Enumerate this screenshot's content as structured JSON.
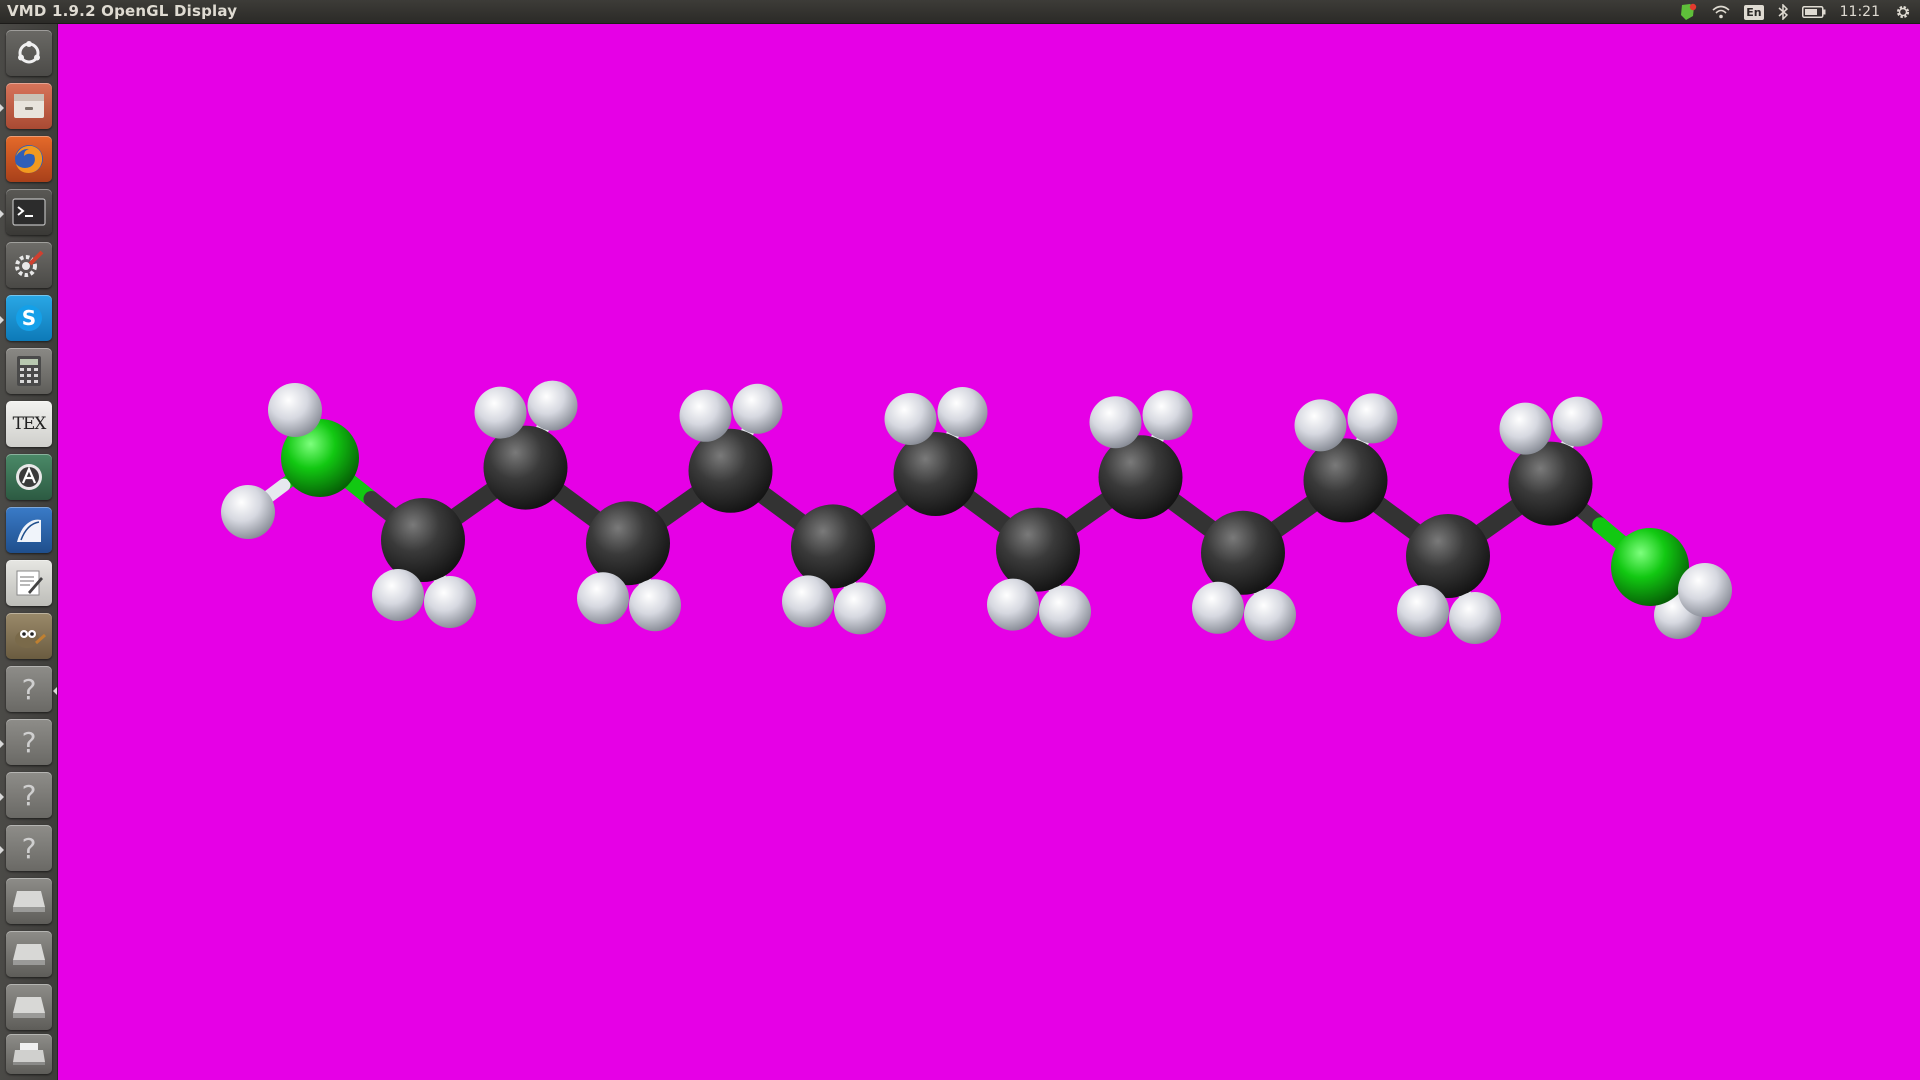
{
  "window": {
    "title": "VMD 1.9.2 OpenGL Display"
  },
  "tray": {
    "keyboard_label": "En",
    "clock": "11:21",
    "icons": [
      "update-shield-icon",
      "wifi-icon",
      "keyboard-layout-icon",
      "bluetooth-icon",
      "battery-icon",
      "settings-gear-icon"
    ]
  },
  "launcher": {
    "items": [
      {
        "name": "dash-home-icon",
        "tooltip": ""
      },
      {
        "name": "files-icon",
        "tooltip": ""
      },
      {
        "name": "firefox-icon",
        "tooltip": ""
      },
      {
        "name": "terminal-icon",
        "tooltip": ""
      },
      {
        "name": "system-settings-icon",
        "tooltip": ""
      },
      {
        "name": "skype-icon",
        "tooltip": ""
      },
      {
        "name": "calculator-icon",
        "tooltip": ""
      },
      {
        "name": "tex-icon",
        "text": "TEX"
      },
      {
        "name": "software-updater-icon",
        "tooltip": ""
      },
      {
        "name": "writer-icon",
        "tooltip": ""
      },
      {
        "name": "text-editor-icon",
        "tooltip": ""
      },
      {
        "name": "gimp-icon",
        "tooltip": ""
      },
      {
        "name": "unknown-app-icon-1",
        "text": "?"
      },
      {
        "name": "unknown-app-icon-2",
        "text": "?"
      },
      {
        "name": "unknown-app-icon-3",
        "text": "?"
      },
      {
        "name": "unknown-app-icon-4",
        "text": "?"
      },
      {
        "name": "drive-icon-1",
        "tooltip": ""
      },
      {
        "name": "drive-icon-2",
        "tooltip": ""
      },
      {
        "name": "drive-icon-3",
        "tooltip": ""
      },
      {
        "name": "printer-icon",
        "tooltip": ""
      }
    ]
  },
  "display": {
    "background_color": "#e600e6",
    "molecule": {
      "carbon_count": 12,
      "nitrogen_count": 2,
      "atom_colors": {
        "C": "#3a3a3a",
        "N": "#12c812",
        "H": "#e6e8ee"
      }
    }
  }
}
